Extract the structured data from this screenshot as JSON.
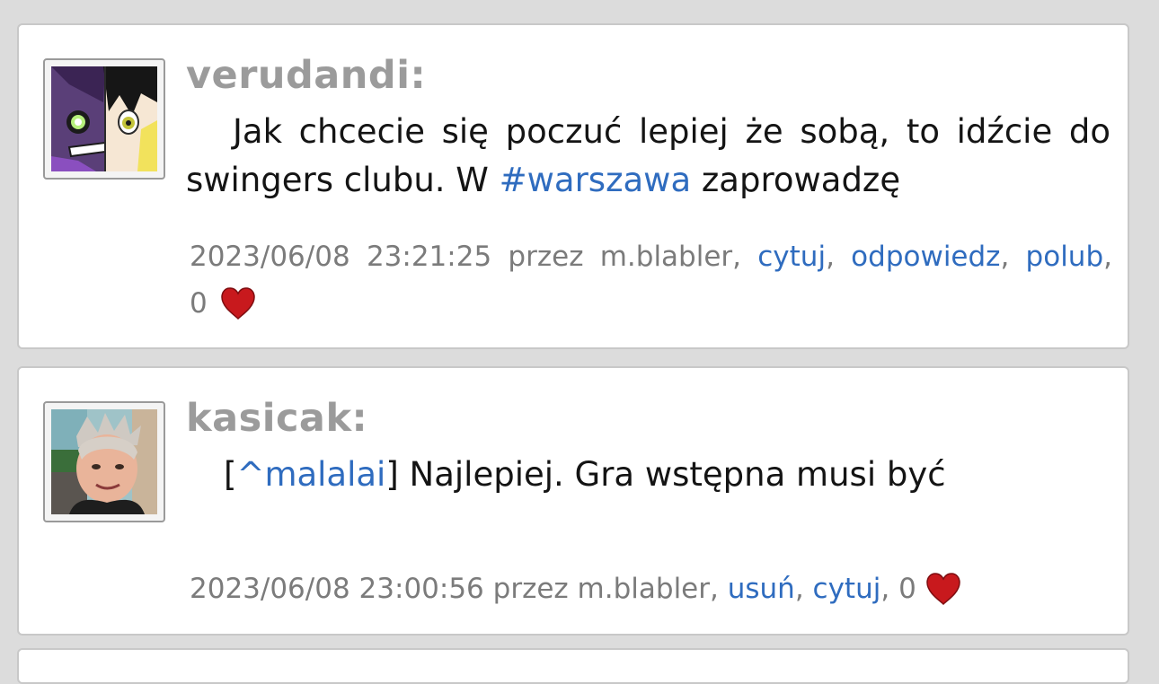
{
  "posts": [
    {
      "username": "verudandi:",
      "text_before": "Jak chcecie się poczuć lepiej że sobą, to idźcie do swingers clubu. W ",
      "hashtag": "#warszawa",
      "text_after": " zaprowadzę",
      "date": "2023/06/08",
      "time": "23:21:25",
      "author_prefix": "przez",
      "author": "m.blabler",
      "actions": [
        "cytuj",
        "odpowiedz",
        "polub"
      ],
      "likes": "0",
      "heart_icon": "heart-icon"
    },
    {
      "username": "kasicak:",
      "reply_open": "[",
      "reply_user": "^malalai",
      "reply_close": "]",
      "text": " Najlepiej. Gra wstępna musi być",
      "date": "2023/06/08",
      "time": "23:00:56",
      "author_prefix": "przez",
      "author": "m.blabler",
      "actions": [
        "usuń",
        "cytuj"
      ],
      "likes": "0",
      "heart_icon": "heart-icon"
    }
  ],
  "colors": {
    "background": "#dcdcdc",
    "card": "#ffffff",
    "username": "#9b9b9b",
    "link": "#2f6cbf",
    "meta": "#7b7b7b",
    "heart": "#c8191d"
  }
}
